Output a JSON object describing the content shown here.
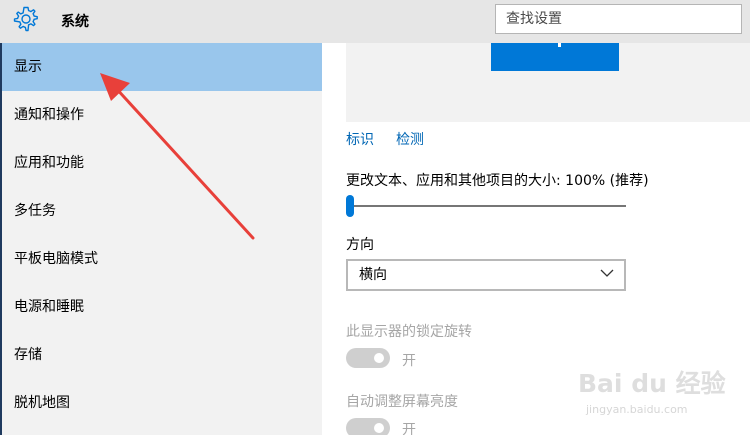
{
  "header": {
    "title": "系统",
    "search_placeholder": "查找设置",
    "icon": "gear-icon"
  },
  "sidebar": {
    "items": [
      {
        "label": "显示",
        "active": true
      },
      {
        "label": "通知和操作",
        "active": false
      },
      {
        "label": "应用和功能",
        "active": false
      },
      {
        "label": "多任务",
        "active": false
      },
      {
        "label": "平板电脑模式",
        "active": false
      },
      {
        "label": "电源和睡眠",
        "active": false
      },
      {
        "label": "存储",
        "active": false
      },
      {
        "label": "脱机地图",
        "active": false
      }
    ]
  },
  "display": {
    "identify_link": "标识",
    "detect_link": "检测",
    "scale_label": "更改文本、应用和其他项目的大小: 100% (推荐)",
    "scale_level": 0,
    "orientation_label": "方向",
    "orientation_value": "横向",
    "rotation_lock_label": "此显示器的锁定旋转",
    "rotation_lock_state": "开",
    "auto_brightness_label": "自动调整屏幕亮度",
    "auto_brightness_state": "开"
  },
  "watermark": {
    "brand": "Bai du 经验",
    "url": "jingyan.baidu.com"
  },
  "colors": {
    "accent": "#0078d7",
    "selected": "#99c6ec",
    "link": "#0066b4",
    "annotation_arrow": "#e8403a"
  }
}
